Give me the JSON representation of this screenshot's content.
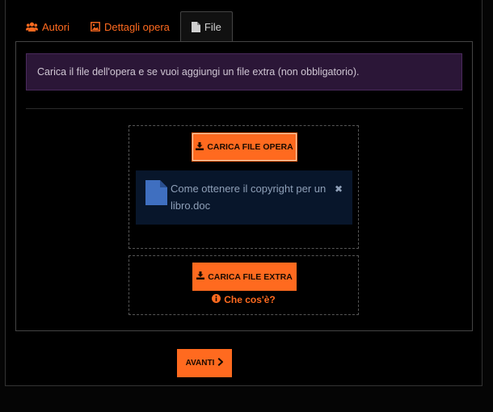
{
  "tabs": [
    {
      "label": "Autori",
      "icon": "users-icon",
      "active": false
    },
    {
      "label": "Dettagli opera",
      "icon": "image-icon",
      "active": false
    },
    {
      "label": "File",
      "icon": "file-icon",
      "active": true
    }
  ],
  "alert": {
    "text": "Carica il file dell'opera e se vuoi aggiungi un file extra (non obbligatorio)."
  },
  "upload_main": {
    "button_label": "CARICA FILE OPERA",
    "file_name": "Come ottenere il copyright per un libro.doc",
    "remove_symbol": "✖"
  },
  "upload_extra": {
    "button_label": "CARICA FILE EXTRA",
    "help_label": "Che cos'è?"
  },
  "next_button": {
    "label": "AVANTI"
  },
  "colors": {
    "accent": "#ff6a1f",
    "alert_bg": "#2b1637",
    "file_bg": "#08162b",
    "file_icon": "#3f6fc0"
  }
}
